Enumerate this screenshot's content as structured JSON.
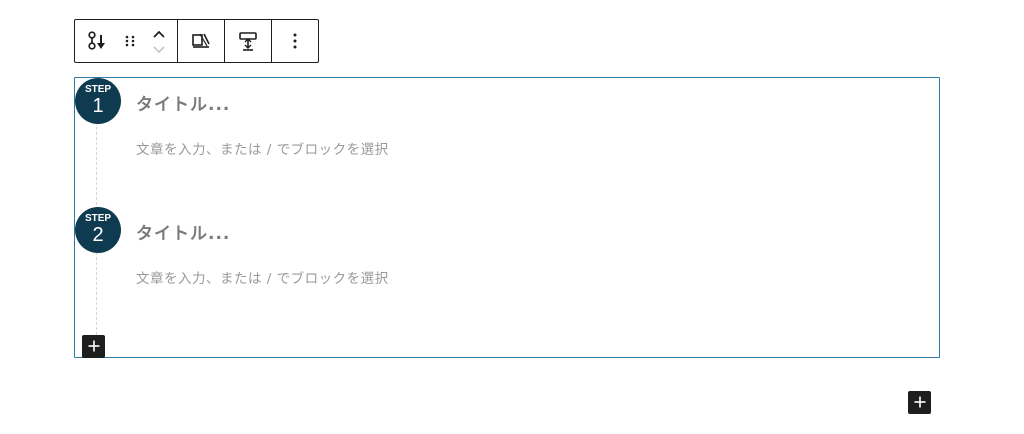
{
  "toolbar": {
    "items": [
      {
        "name": "step-block-type-icon"
      },
      {
        "name": "drag-handle-icon"
      },
      {
        "name": "move-up-icon"
      },
      {
        "name": "move-down-icon"
      },
      {
        "name": "align-icon"
      },
      {
        "name": "vertical-align-icon"
      },
      {
        "name": "more-options-icon"
      }
    ]
  },
  "steps": [
    {
      "label": "STEP",
      "number": "1",
      "title_placeholder": "タイトル...",
      "body_placeholder": "文章を入力、または / でブロックを選択"
    },
    {
      "label": "STEP",
      "number": "2",
      "title_placeholder": "タイトル...",
      "body_placeholder": "文章を入力、または / でブロックを選択"
    }
  ],
  "add_inner_icon": "plus-icon",
  "add_block_icon": "plus-icon",
  "colors": {
    "badge": "#0e3b4f",
    "selection_border": "#2f7ba4",
    "toolbar_border": "#1e1e1e",
    "placeholder_text": "#9a9a9a"
  }
}
